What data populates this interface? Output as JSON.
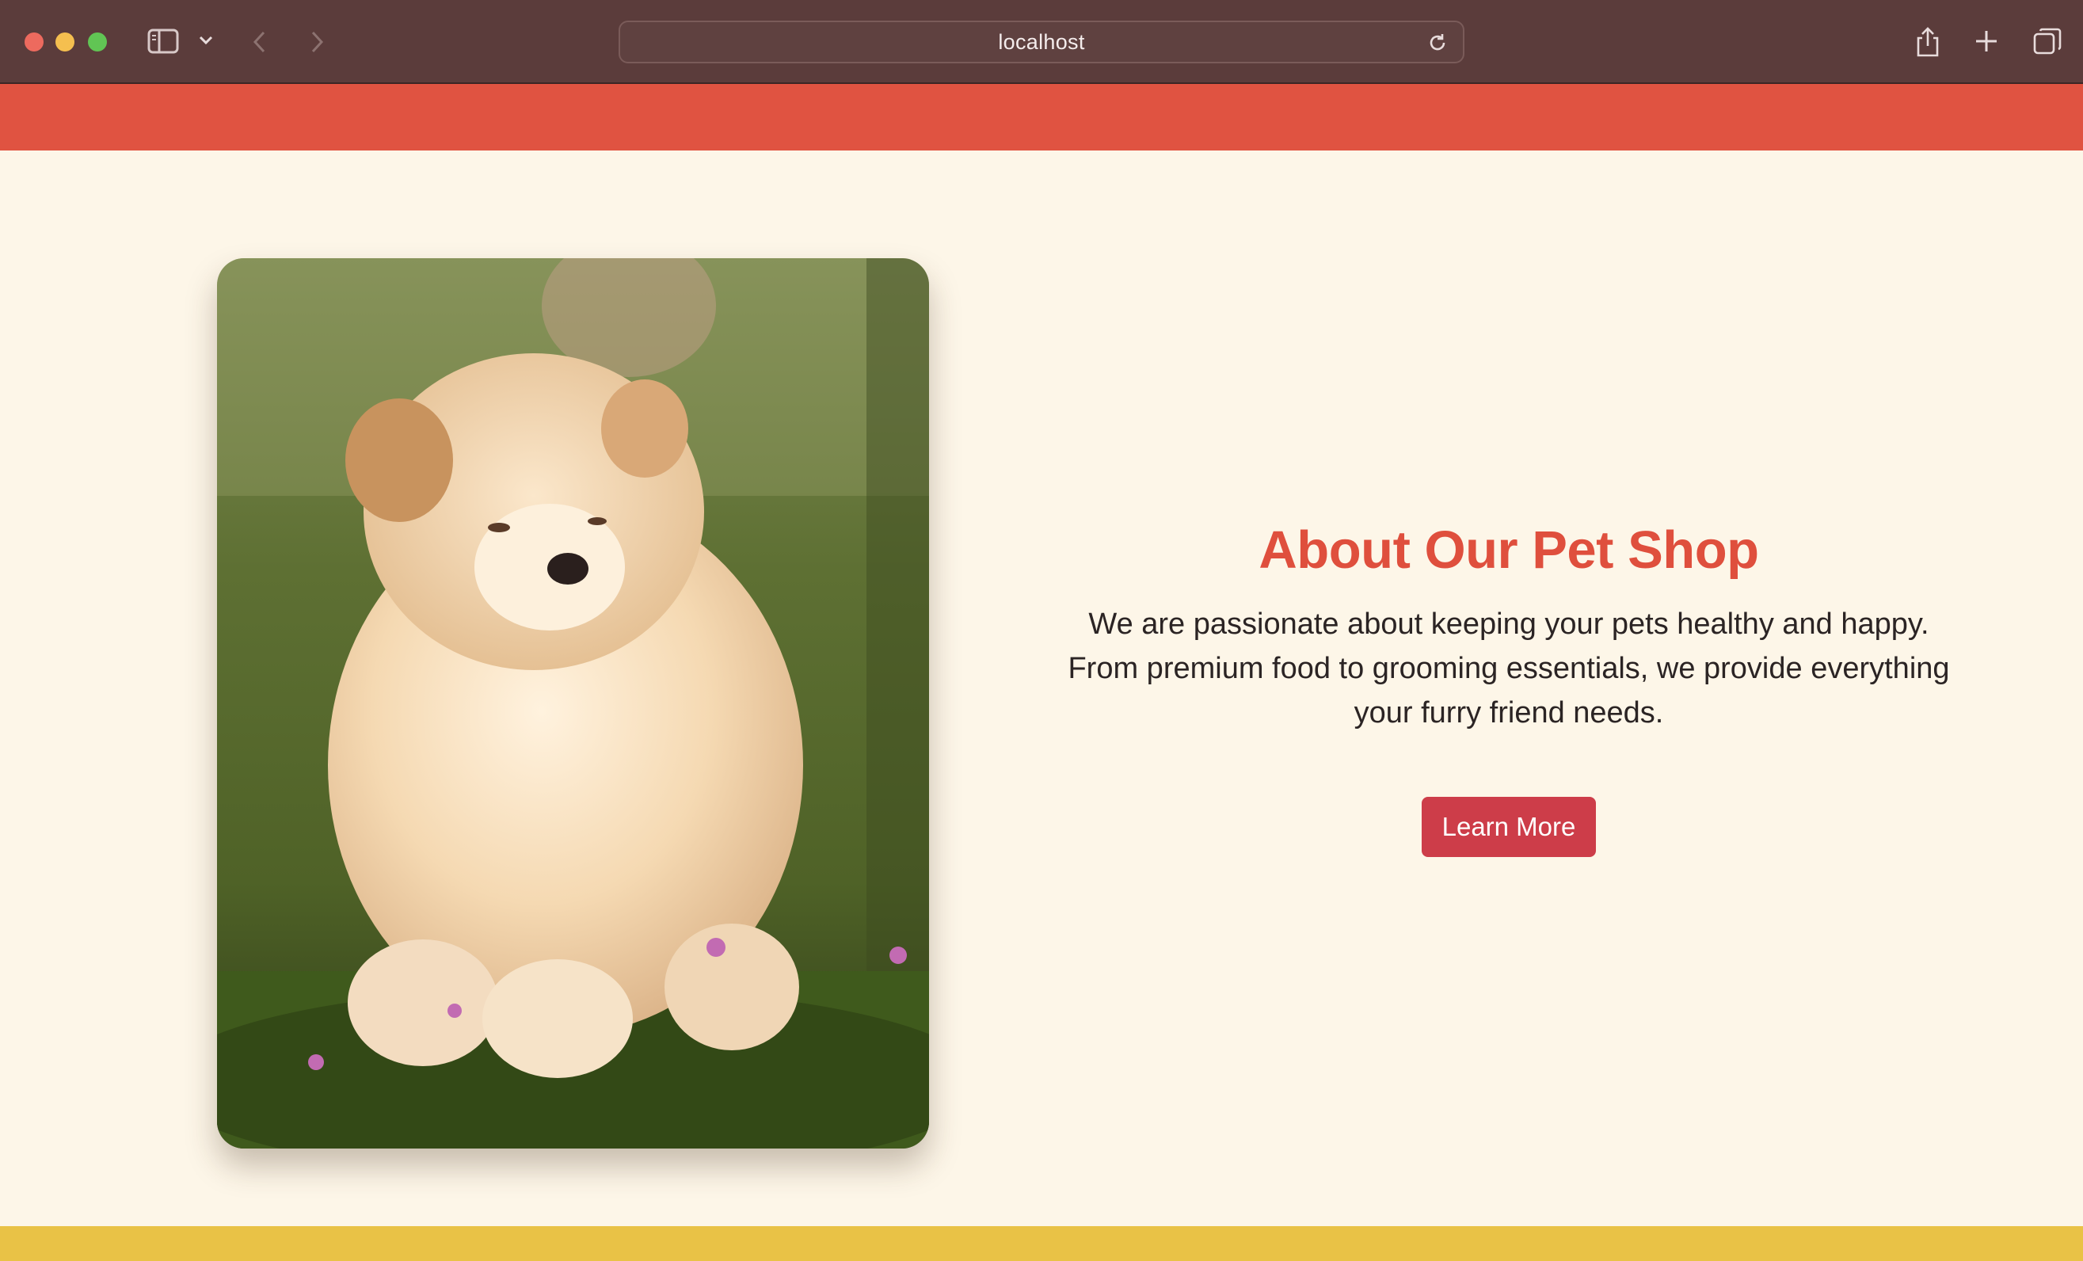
{
  "browser": {
    "address": "localhost",
    "icons": {
      "sidebar": "sidebar-icon",
      "tab_menu": "chevron-down-icon",
      "back": "chevron-left-icon",
      "forward": "chevron-right-icon",
      "reload": "reload-icon",
      "share": "share-icon",
      "new_tab": "plus-icon",
      "tab_overview": "tabs-icon"
    }
  },
  "theme": {
    "header_color": "#e05341",
    "footer_color": "#e9c246",
    "page_background": "#fdf6e8",
    "heading_color": "#df4f3d",
    "button_color": "#cd3d49"
  },
  "about": {
    "title": "About Our Pet Shop",
    "description": "We are passionate about keeping your pets healthy and happy. From premium food to grooming essentials, we provide everything your furry friend needs.",
    "button_label": "Learn More"
  }
}
